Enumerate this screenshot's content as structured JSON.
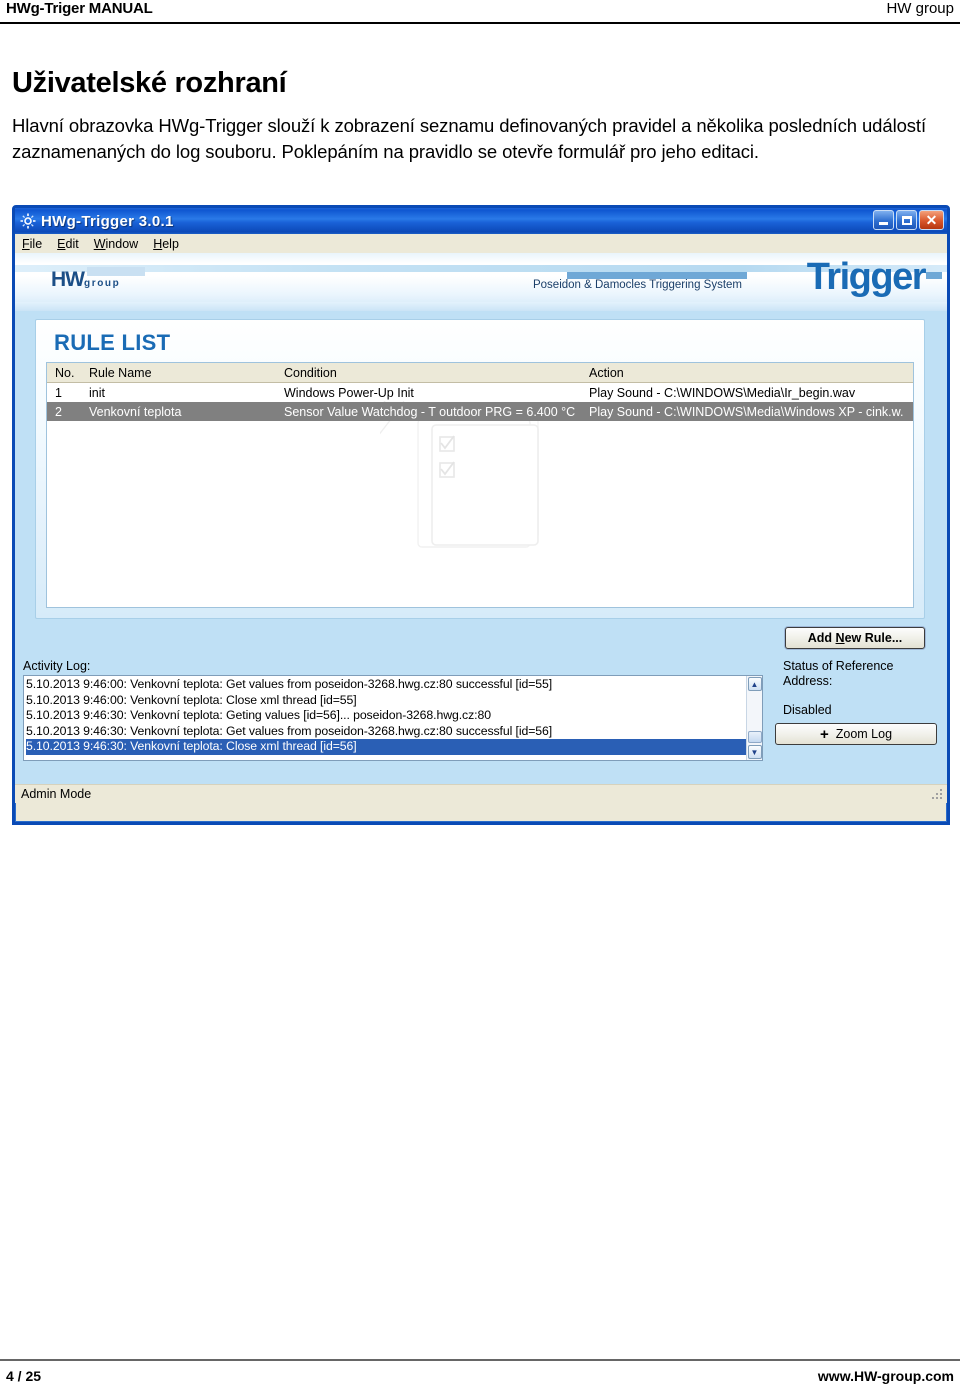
{
  "doc": {
    "header_left": "HWg-Triger MANUAL",
    "header_right": "HW group",
    "title": "Uživatelské rozhraní",
    "paragraph": "Hlavní obrazovka HWg-Trigger slouží k zobrazení seznamu definovaných pravidel a několika posledních událostí zaznamenaných do log souboru. Poklepáním na pravidlo se otevře formulář pro jeho editaci.",
    "footer_page": "4 / 25",
    "footer_site": "www.HW-group.com"
  },
  "app": {
    "window_title": "HWg-Trigger 3.0.1",
    "window_buttons": {
      "minimize": "_",
      "maximize": "□",
      "close": "✕"
    },
    "menu": [
      {
        "label": "File",
        "accel": "F"
      },
      {
        "label": "Edit",
        "accel": "E"
      },
      {
        "label": "Window",
        "accel": "W"
      },
      {
        "label": "Help",
        "accel": "H"
      }
    ],
    "banner": {
      "logo_main": "HW",
      "logo_sub": "group",
      "tagline": "Poseidon & Damocles Triggering System",
      "product": "Trigger"
    },
    "rule_list": {
      "title": "RULE LIST",
      "columns": [
        "No.",
        "Rule Name",
        "Condition",
        "Action"
      ],
      "rows": [
        {
          "no": "1",
          "name": "init",
          "condition": "Windows Power-Up Init",
          "action": "Play Sound - C:\\WINDOWS\\Media\\Ir_begin.wav",
          "selected": false
        },
        {
          "no": "2",
          "name": "Venkovní teplota",
          "condition": "Sensor Value Watchdog  -  T outdoor PRG = 6.400 °C",
          "action": "Play Sound - C:\\WINDOWS\\Media\\Windows XP - cink.w.",
          "selected": true
        }
      ],
      "add_button": "Add New Rule...",
      "add_button_accel": "N"
    },
    "activity_log": {
      "label": "Activity Log:",
      "lines": [
        {
          "text": "5.10.2013 9:46:00: Venkovní teplota: Get values from poseidon-3268.hwg.cz:80 successful [id=55]",
          "selected": false
        },
        {
          "text": "5.10.2013 9:46:00: Venkovní teplota: Close xml thread [id=55]",
          "selected": false
        },
        {
          "text": "5.10.2013 9:46:30: Venkovní teplota: Geting values [id=56]... poseidon-3268.hwg.cz:80",
          "selected": false
        },
        {
          "text": "5.10.2013 9:46:30: Venkovní teplota: Get values from poseidon-3268.hwg.cz:80 successful [id=56]",
          "selected": false
        },
        {
          "text": "5.10.2013 9:46:30: Venkovní teplota: Close xml thread [id=56]",
          "selected": true
        }
      ],
      "scroll_up": "▲",
      "scroll_down": "▼"
    },
    "reference": {
      "label": "Status of Reference Address:",
      "value": "Disabled",
      "zoom_button": "Zoom Log",
      "zoom_button_plus": "+"
    },
    "status_bar": {
      "text": "Admin Mode"
    }
  },
  "colors": {
    "title_bar": "#0f56d1",
    "client_background": "#bfe0f5",
    "accent_blue": "#1a6bb5",
    "selection_gray": "#808080",
    "selection_blue": "#2a5fb5",
    "menu_background": "#ece9d8"
  }
}
